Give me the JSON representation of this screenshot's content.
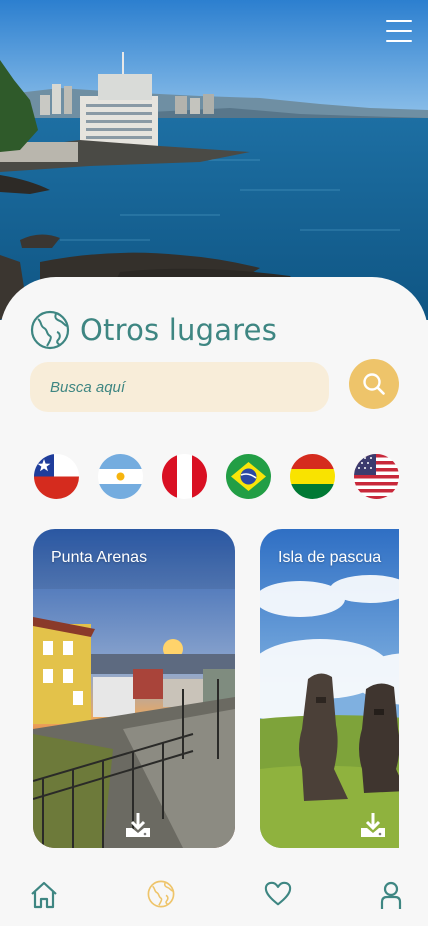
{
  "header": {
    "menu_icon": "hamburger-menu-icon",
    "hero_image": "valparaiso-coastline"
  },
  "section": {
    "title": "Otros lugares",
    "icon": "globe-icon"
  },
  "search": {
    "placeholder": "Busca aquí",
    "icon": "search-icon"
  },
  "flags": [
    {
      "country": "chile",
      "icon": "chile-flag-icon"
    },
    {
      "country": "argentina",
      "icon": "argentina-flag-icon"
    },
    {
      "country": "peru",
      "icon": "peru-flag-icon"
    },
    {
      "country": "brazil",
      "icon": "brazil-flag-icon"
    },
    {
      "country": "bolivia",
      "icon": "bolivia-flag-icon"
    },
    {
      "country": "usa",
      "icon": "usa-flag-icon"
    }
  ],
  "cards": [
    {
      "title": "Punta Arenas",
      "icon": "download-icon"
    },
    {
      "title": "Isla de pascua",
      "icon": "download-icon"
    }
  ],
  "nav": {
    "items": [
      {
        "name": "home",
        "icon": "home-icon",
        "active": false
      },
      {
        "name": "places",
        "icon": "globe-icon",
        "active": true
      },
      {
        "name": "favorites",
        "icon": "heart-icon",
        "active": false
      },
      {
        "name": "profile",
        "icon": "user-icon",
        "active": false
      }
    ]
  },
  "colors": {
    "teal": "#3e8682",
    "gold": "#eec46a",
    "search_bg": "#f8edd9",
    "background": "#f7f7f7"
  }
}
